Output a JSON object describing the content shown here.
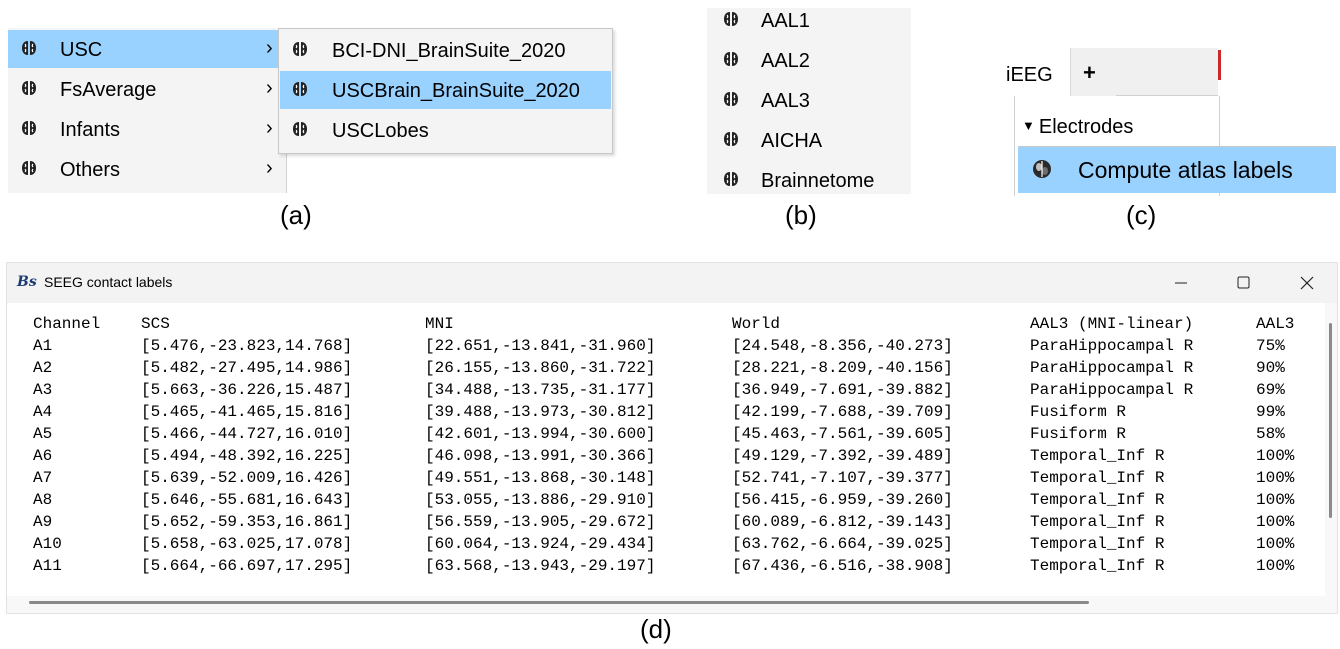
{
  "panel_a": {
    "menu": [
      {
        "label": "USC",
        "selected": true
      },
      {
        "label": "FsAverage",
        "selected": false
      },
      {
        "label": "Infants",
        "selected": false
      },
      {
        "label": "Others",
        "selected": false
      }
    ],
    "submenu": [
      {
        "label": "BCI-DNI_BrainSuite_2020",
        "selected": false
      },
      {
        "label": "USCBrain_BrainSuite_2020",
        "selected": true
      },
      {
        "label": "USCLobes",
        "selected": false
      }
    ],
    "chevron": "›"
  },
  "panel_b": {
    "items": [
      "AAL1",
      "AAL2",
      "AAL3",
      "AICHA",
      "Brainnetome"
    ]
  },
  "panel_c": {
    "tab_label": "iEEG",
    "add_tab_label": "+",
    "tree_node": "Electrodes",
    "menu_item": "Compute atlas labels"
  },
  "captions": {
    "a": "(a)",
    "b": "(b)",
    "c": "(c)",
    "d": "(d)"
  },
  "window": {
    "logo": "Bs",
    "title": "SEEG contact labels",
    "headers": {
      "channel": "Channel",
      "scs": "SCS",
      "mni": "MNI",
      "world": "World",
      "atlas": "AAL3 (MNI-linear)",
      "pct": "AAL3"
    },
    "rows": [
      {
        "channel": "A1",
        "scs": "[5.476,-23.823,14.768]",
        "mni": "[22.651,-13.841,-31.960]",
        "world": "[24.548,-8.356,-40.273]",
        "atlas": "ParaHippocampal R",
        "pct": "75%"
      },
      {
        "channel": "A2",
        "scs": "[5.482,-27.495,14.986]",
        "mni": "[26.155,-13.860,-31.722]",
        "world": "[28.221,-8.209,-40.156]",
        "atlas": "ParaHippocampal R",
        "pct": "90%"
      },
      {
        "channel": "A3",
        "scs": "[5.663,-36.226,15.487]",
        "mni": "[34.488,-13.735,-31.177]",
        "world": "[36.949,-7.691,-39.882]",
        "atlas": "ParaHippocampal R",
        "pct": "69%"
      },
      {
        "channel": "A4",
        "scs": "[5.465,-41.465,15.816]",
        "mni": "[39.488,-13.973,-30.812]",
        "world": "[42.199,-7.688,-39.709]",
        "atlas": "Fusiform R",
        "pct": "99%"
      },
      {
        "channel": "A5",
        "scs": "[5.466,-44.727,16.010]",
        "mni": "[42.601,-13.994,-30.600]",
        "world": "[45.463,-7.561,-39.605]",
        "atlas": "Fusiform R",
        "pct": "58%"
      },
      {
        "channel": "A6",
        "scs": "[5.494,-48.392,16.225]",
        "mni": "[46.098,-13.991,-30.366]",
        "world": "[49.129,-7.392,-39.489]",
        "atlas": "Temporal_Inf R",
        "pct": "100%"
      },
      {
        "channel": "A7",
        "scs": "[5.639,-52.009,16.426]",
        "mni": "[49.551,-13.868,-30.148]",
        "world": "[52.741,-7.107,-39.377]",
        "atlas": "Temporal_Inf R",
        "pct": "100%"
      },
      {
        "channel": "A8",
        "scs": "[5.646,-55.681,16.643]",
        "mni": "[53.055,-13.886,-29.910]",
        "world": "[56.415,-6.959,-39.260]",
        "atlas": "Temporal_Inf R",
        "pct": "100%"
      },
      {
        "channel": "A9",
        "scs": "[5.652,-59.353,16.861]",
        "mni": "[56.559,-13.905,-29.672]",
        "world": "[60.089,-6.812,-39.143]",
        "atlas": "Temporal_Inf R",
        "pct": "100%"
      },
      {
        "channel": "A10",
        "scs": "[5.658,-63.025,17.078]",
        "mni": "[60.064,-13.924,-29.434]",
        "world": "[63.762,-6.664,-39.025]",
        "atlas": "Temporal_Inf R",
        "pct": "100%"
      },
      {
        "channel": "A11",
        "scs": "[5.664,-66.697,17.295]",
        "mni": "[63.568,-13.943,-29.197]",
        "world": "[67.436,-6.516,-38.908]",
        "atlas": "Temporal_Inf R",
        "pct": "100%"
      }
    ]
  },
  "icons": {
    "brain": "brain-icon",
    "brain_filled": "brain-3d-icon",
    "minimize": "minimize-icon",
    "maximize": "maximize-icon",
    "close": "close-icon"
  },
  "colors": {
    "selection": "#99d1ff",
    "menu_bg": "#f4f4f4",
    "logo": "#1e3a73",
    "tab_red": "#cc2a2a"
  }
}
